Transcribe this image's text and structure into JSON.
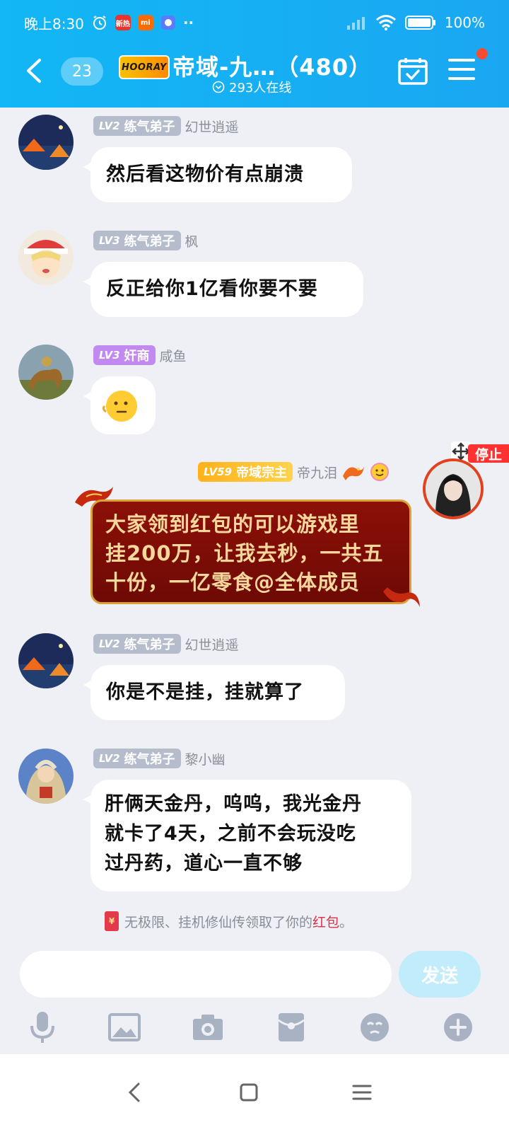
{
  "status_bar": {
    "time": "晚上8:30",
    "notif_1": "新热",
    "notif_2": "mi",
    "dots": "··",
    "battery": "100%"
  },
  "header": {
    "unread_count": "23",
    "logo_text": "HOORAY",
    "group_title": "帝域-九…（480）",
    "online": "293人在线",
    "accent": "#12b7f5"
  },
  "messages": [
    {
      "level": "LV2",
      "title": "练气弟子",
      "sender": "幻世逍遥",
      "text": "然后看这物价有点崩溃"
    },
    {
      "level": "LV3",
      "title": "练气弟子",
      "sender": "枫",
      "text": "反正给你1亿看你要不要"
    },
    {
      "level": "LV3",
      "title": "奸商",
      "sender": "咸鱼",
      "text": "😐"
    },
    {
      "level": "LV59",
      "title": "帝域宗主",
      "sender": "帝九泪",
      "line1": "大家领到红包的可以游戏里",
      "line2": "挂200万，让我去秒，一共五",
      "line3": "十份，一亿零食@全体成员"
    },
    {
      "level": "LV2",
      "title": "练气弟子",
      "sender": "幻世逍遥",
      "text": "你是不是挂，挂就算了"
    },
    {
      "level": "LV2",
      "title": "练气弟子",
      "sender": "黎小幽",
      "line1": "肝俩天金丹，呜呜，我光金丹",
      "line2": "就卡了4天，之前不会玩没吃",
      "line3": "过丹药，道心一直不够"
    }
  ],
  "system_notice": {
    "prefix": "无极限、挂机修仙传领取了你的",
    "highlight": "红包",
    "suffix": "。",
    "icon_char": "¥"
  },
  "float_tag": "停止",
  "composer": {
    "placeholder": "",
    "send_label": "发送"
  }
}
